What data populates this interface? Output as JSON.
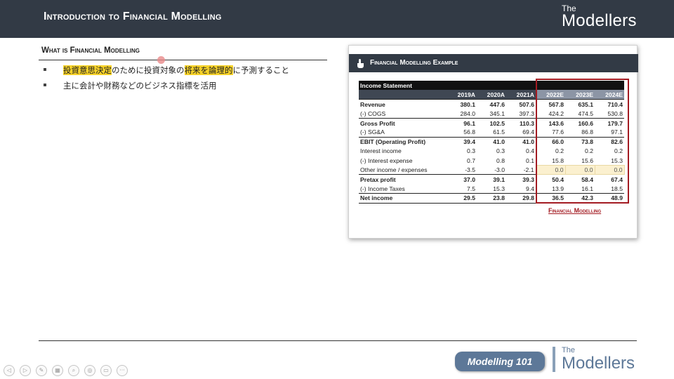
{
  "header": {
    "title": "Introduction to Financial Modelling",
    "logo_the": "The",
    "logo_word": "Modellers"
  },
  "section": {
    "heading": "What is Financial Modelling",
    "bullets": [
      {
        "parts": [
          "投資意思決定",
          "のために投資対象の",
          "将来を論理的",
          "に予測すること"
        ]
      },
      {
        "text": "主に会計や財務などのビジネス指標を活用"
      }
    ]
  },
  "card": {
    "title": "Financial Modelling Example",
    "caption": "Financial Modelling",
    "icon": "hand-pointer-icon"
  },
  "table": {
    "title": "Income Statement",
    "years": [
      "2019A",
      "2020A",
      "2021A",
      "2022E",
      "2023E",
      "2024E"
    ],
    "rows": [
      {
        "label": "Revenue",
        "values": [
          "380.1",
          "447.6",
          "507.6",
          "567.8",
          "635.1",
          "710.4"
        ],
        "bold": true
      },
      {
        "label": "(-) COGS",
        "values": [
          "284.0",
          "345.1",
          "397.3",
          "424.2",
          "474.5",
          "530.8"
        ]
      },
      {
        "label": "Gross Profit",
        "values": [
          "96.1",
          "102.5",
          "110.3",
          "143.6",
          "160.6",
          "179.7"
        ],
        "bold": true
      },
      {
        "label": "(-) SG&A",
        "values": [
          "56.8",
          "61.5",
          "69.4",
          "77.6",
          "86.8",
          "97.1"
        ]
      },
      {
        "label": "EBIT (Operating Profit)",
        "values": [
          "39.4",
          "41.0",
          "41.0",
          "66.0",
          "73.8",
          "82.6"
        ],
        "bold": true
      },
      {
        "label": "Interest income",
        "values": [
          "0.3",
          "0.3",
          "0.4",
          "0.2",
          "0.2",
          "0.2"
        ]
      },
      {
        "label": "(-) Interest expense",
        "values": [
          "0.7",
          "0.8",
          "0.1",
          "15.8",
          "15.6",
          "15.3"
        ]
      },
      {
        "label": "Other income / expenses",
        "values": [
          "-3.5",
          "-3.0",
          "-2.1",
          "0.0",
          "0.0",
          "0.0"
        ],
        "input": true
      },
      {
        "label": "Pretax profit",
        "values": [
          "37.0",
          "39.1",
          "39.3",
          "50.4",
          "58.4",
          "67.4"
        ],
        "bold": true
      },
      {
        "label": "(-) Income Taxes",
        "values": [
          "7.5",
          "15.3",
          "9.4",
          "13.9",
          "16.1",
          "18.5"
        ]
      },
      {
        "label": "Net income",
        "values": [
          "29.5",
          "23.8",
          "29.8",
          "36.5",
          "42.3",
          "48.9"
        ],
        "net": true
      }
    ]
  },
  "footer": {
    "badge": "Modelling 101",
    "logo_the": "The",
    "logo_word": "Modellers"
  },
  "controls": [
    {
      "icon": "prev-icon",
      "glyph": "◁"
    },
    {
      "icon": "next-icon",
      "glyph": "▷"
    },
    {
      "icon": "pen-icon",
      "glyph": "✎"
    },
    {
      "icon": "slides-icon",
      "glyph": "▦"
    },
    {
      "icon": "zoom-icon",
      "glyph": "⌕"
    },
    {
      "icon": "pointer-icon",
      "glyph": "◎"
    },
    {
      "icon": "camera-icon",
      "glyph": "▭"
    },
    {
      "icon": "more-icon",
      "glyph": "···"
    }
  ],
  "colors": {
    "header_bg": "#323a45",
    "highlight": "#f7d228",
    "accent_red": "#a31b22",
    "badge_bg": "#5d7898"
  }
}
